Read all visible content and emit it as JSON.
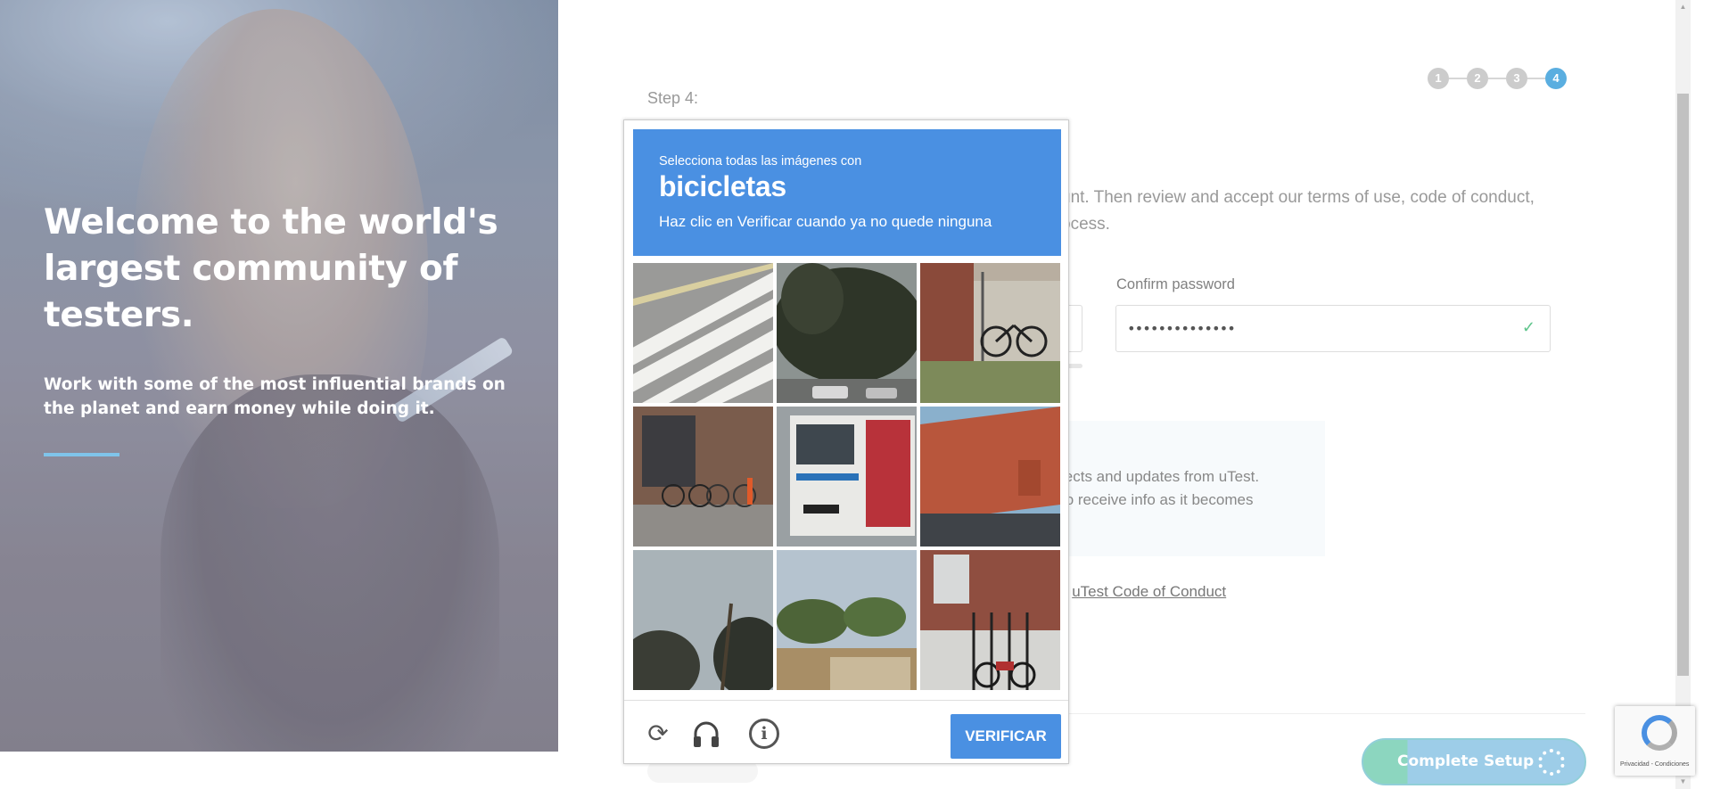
{
  "hero": {
    "title": "Welcome to the world's largest community of testers.",
    "subtitle": "Work with some of the most influential brands on the planet and earn money while doing it."
  },
  "form": {
    "step_label": "Step 4:",
    "steps": [
      "1",
      "2",
      "3",
      "4"
    ],
    "active_step": 4,
    "intro_line1": "unt. Then review and accept our terms of use, code of conduct,",
    "intro_line2": "ocess.",
    "confirm_password_label": "Confirm password",
    "confirm_password_value": "••••••••••••••",
    "notice_line1": "jects and updates from uTest.",
    "notice_line2": "to receive info as it becomes",
    "coc_prefix": "e",
    "coc_link": "uTest Code of Conduct",
    "complete_button": "Complete Setup"
  },
  "captcha": {
    "instruction": "Selecciona todas las imágenes con",
    "keyword": "bicicletas",
    "hint": "Haz clic en Verificar cuando ya no quede ninguna",
    "verify_button": "VERIFICAR",
    "tiles": [
      "crosswalk-stripes",
      "dark-trees-cars",
      "bicycle-against-fence",
      "brick-wall-bikes",
      "city-bus",
      "orange-wall-lot",
      "palm-trees-sky",
      "palm-trees-street",
      "brick-house-bike"
    ],
    "footer_icons": [
      "reload-icon",
      "audio-headphones-icon",
      "info-icon"
    ]
  },
  "recaptcha_badge": {
    "terms": "Privacidad - Condiciones"
  }
}
